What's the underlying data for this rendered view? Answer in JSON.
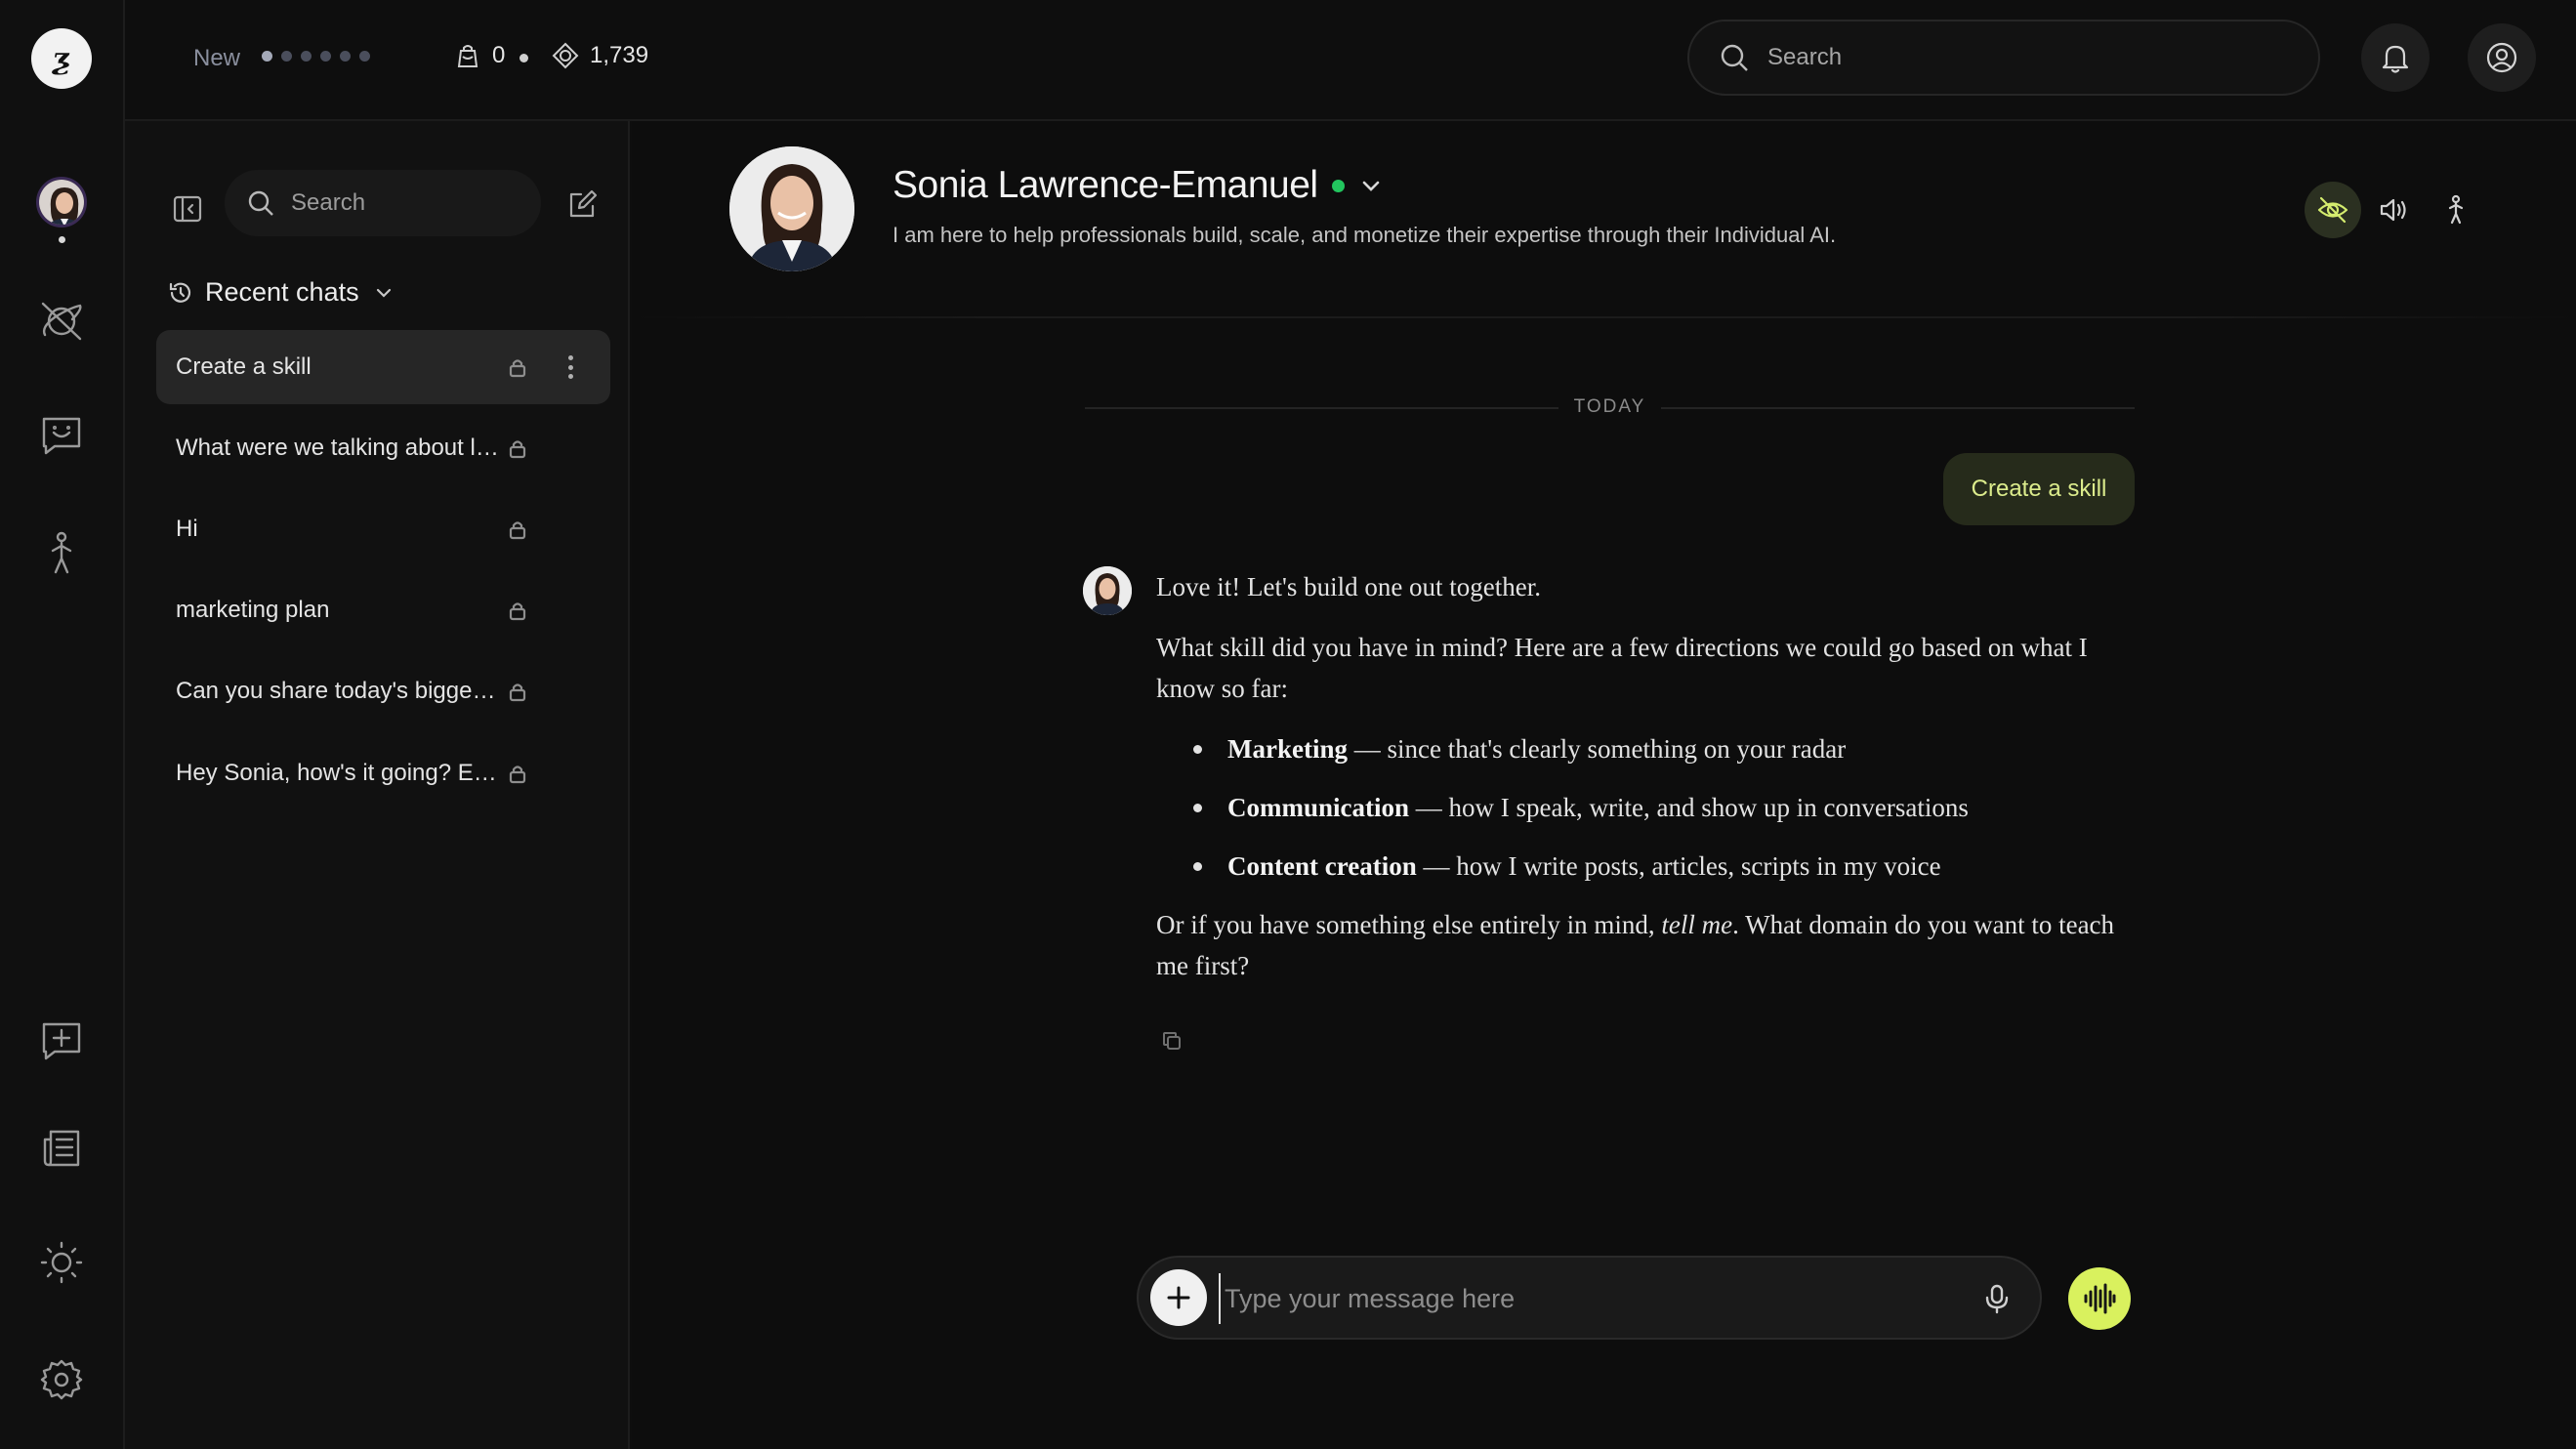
{
  "app": {
    "logo_text": "ƺ",
    "accent_color": "#d9f15e",
    "online_color": "#22c55e"
  },
  "topbar": {
    "new_label": "New",
    "progress_dots_total": 6,
    "progress_dots_filled": 1,
    "counter_a_value": "0",
    "counter_a_icon": "bag-icon",
    "counter_b_value": "1,739",
    "counter_b_icon": "coin-icon",
    "search_placeholder": "Search",
    "notification_icon": "bell-icon",
    "profile_icon": "user-circle-icon"
  },
  "rail": {
    "items": [
      {
        "name": "avatar"
      },
      {
        "name": "explore-icon"
      },
      {
        "name": "chat-icon"
      },
      {
        "name": "person-icon"
      },
      {
        "name": "feedback-icon"
      },
      {
        "name": "news-icon"
      },
      {
        "name": "theme-sun-icon"
      },
      {
        "name": "settings-icon"
      }
    ]
  },
  "panel": {
    "search_placeholder": "Search",
    "recent_label": "Recent chats",
    "chats": [
      {
        "title": "Create a skill",
        "active": true
      },
      {
        "title": "What were we talking about last time?",
        "active": false
      },
      {
        "title": "Hi",
        "active": false
      },
      {
        "title": "marketing plan",
        "active": false
      },
      {
        "title": "Can you share today's biggest news?",
        "active": false
      },
      {
        "title": "Hey Sonia, how's it going? Excited to chat",
        "active": false
      }
    ]
  },
  "profile": {
    "name": "Sonia Lawrence-Emanuel",
    "description": "I am here to help professionals build, scale, and monetize their expertise through their Individual AI."
  },
  "conversation": {
    "day_label": "TODAY",
    "user_message": "Create a skill",
    "bot": {
      "p1": "Love it! Let's build one out together.",
      "p2": "What skill did you have in mind? Here are a few directions we could go based on what I know so far:",
      "bullets": [
        {
          "bold": "Marketing",
          "rest": " — since that's clearly something on your radar"
        },
        {
          "bold": "Communication",
          "rest": " — how I speak, write, and show up in conversations"
        },
        {
          "bold": "Content creation",
          "rest": " — how I write posts, articles, scripts in my voice"
        }
      ],
      "p3_before": "Or if you have something else entirely in mind, ",
      "p3_em": "tell me",
      "p3_after": ". What domain do you want to teach me first?"
    }
  },
  "composer": {
    "placeholder": "Type your message here",
    "value": ""
  }
}
